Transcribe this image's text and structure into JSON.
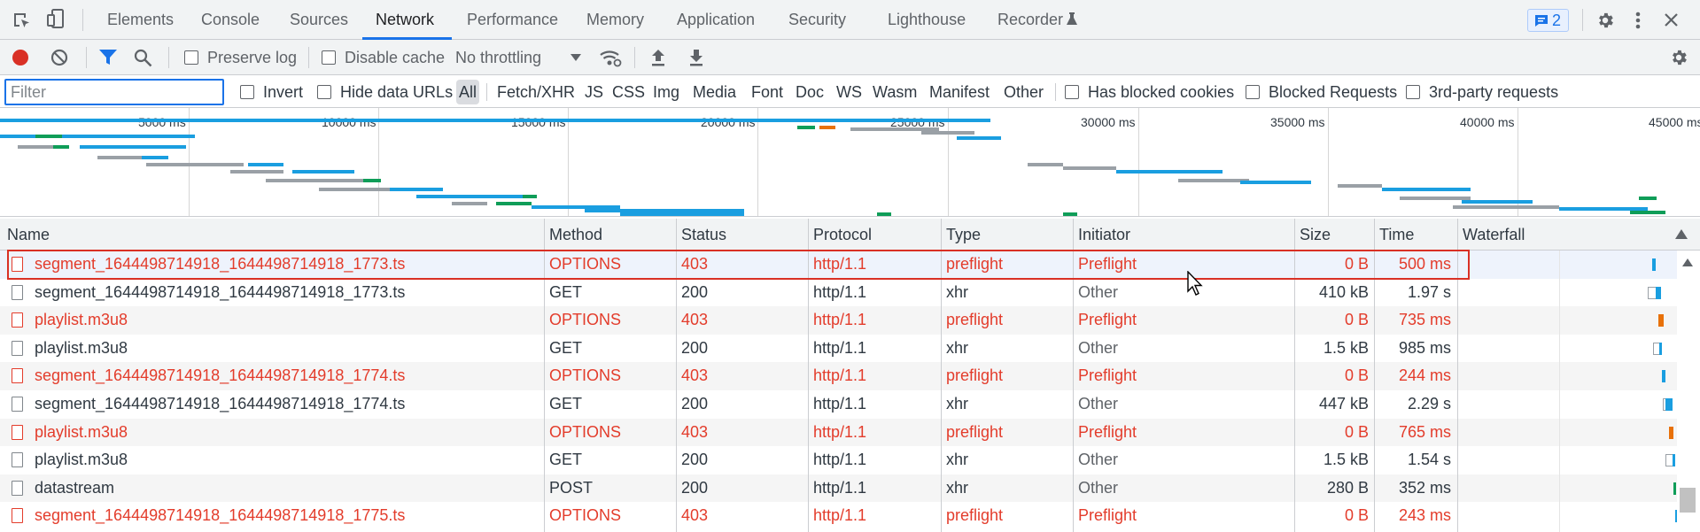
{
  "tabs": {
    "items": [
      "Elements",
      "Console",
      "Sources",
      "Network",
      "Performance",
      "Memory",
      "Application",
      "Security",
      "Lighthouse",
      "Recorder"
    ],
    "active": "Network",
    "issues_count": "2"
  },
  "toolbar": {
    "preserve_log": "Preserve log",
    "disable_cache": "Disable cache",
    "throttling": "No throttling"
  },
  "filter": {
    "placeholder": "Filter",
    "invert": "Invert",
    "hide_data_urls": "Hide data URLs",
    "types": [
      "All",
      "Fetch/XHR",
      "JS",
      "CSS",
      "Img",
      "Media",
      "Font",
      "Doc",
      "WS",
      "Wasm",
      "Manifest",
      "Other"
    ],
    "active_type": "All",
    "has_blocked_cookies": "Has blocked cookies",
    "blocked_requests": "Blocked Requests",
    "third_party": "3rd-party requests"
  },
  "overview": {
    "ticks": [
      "5000 ms",
      "10000 ms",
      "15000 ms",
      "20000 ms",
      "25000 ms",
      "30000 ms",
      "35000 ms",
      "40000 ms",
      "45000 ms"
    ]
  },
  "table": {
    "columns": [
      "Name",
      "Method",
      "Status",
      "Protocol",
      "Type",
      "Initiator",
      "Size",
      "Time",
      "Waterfall"
    ],
    "rows": [
      {
        "name": "segment_1644498714918_1644498714918_1773.ts",
        "method": "OPTIONS",
        "status": "403",
        "protocol": "http/1.1",
        "type": "preflight",
        "initiator": "Preflight",
        "size": "0 B",
        "time": "500 ms",
        "error": true
      },
      {
        "name": "segment_1644498714918_1644498714918_1773.ts",
        "method": "GET",
        "status": "200",
        "protocol": "http/1.1",
        "type": "xhr",
        "initiator": "Other",
        "size": "410 kB",
        "time": "1.97 s",
        "error": false
      },
      {
        "name": "playlist.m3u8",
        "method": "OPTIONS",
        "status": "403",
        "protocol": "http/1.1",
        "type": "preflight",
        "initiator": "Preflight",
        "size": "0 B",
        "time": "735 ms",
        "error": true
      },
      {
        "name": "playlist.m3u8",
        "method": "GET",
        "status": "200",
        "protocol": "http/1.1",
        "type": "xhr",
        "initiator": "Other",
        "size": "1.5 kB",
        "time": "985 ms",
        "error": false
      },
      {
        "name": "segment_1644498714918_1644498714918_1774.ts",
        "method": "OPTIONS",
        "status": "403",
        "protocol": "http/1.1",
        "type": "preflight",
        "initiator": "Preflight",
        "size": "0 B",
        "time": "244 ms",
        "error": true
      },
      {
        "name": "segment_1644498714918_1644498714918_1774.ts",
        "method": "GET",
        "status": "200",
        "protocol": "http/1.1",
        "type": "xhr",
        "initiator": "Other",
        "size": "447 kB",
        "time": "2.29 s",
        "error": false
      },
      {
        "name": "playlist.m3u8",
        "method": "OPTIONS",
        "status": "403",
        "protocol": "http/1.1",
        "type": "preflight",
        "initiator": "Preflight",
        "size": "0 B",
        "time": "765 ms",
        "error": true
      },
      {
        "name": "playlist.m3u8",
        "method": "GET",
        "status": "200",
        "protocol": "http/1.1",
        "type": "xhr",
        "initiator": "Other",
        "size": "1.5 kB",
        "time": "1.54 s",
        "error": false
      },
      {
        "name": "datastream",
        "method": "POST",
        "status": "200",
        "protocol": "http/1.1",
        "type": "xhr",
        "initiator": "Other",
        "size": "280 B",
        "time": "352 ms",
        "error": false
      },
      {
        "name": "segment_1644498714918_1644498714918_1775.ts",
        "method": "OPTIONS",
        "status": "403",
        "protocol": "http/1.1",
        "type": "preflight",
        "initiator": "Preflight",
        "size": "0 B",
        "time": "243 ms",
        "error": true
      }
    ]
  },
  "colors": {
    "accent": "#1a73e8",
    "error": "#e33c2b",
    "waterfall_blue": "#1a9ee0",
    "waterfall_green": "#0f9d58",
    "waterfall_gray": "#9aa0a6",
    "waterfall_orange": "#e8710a"
  }
}
